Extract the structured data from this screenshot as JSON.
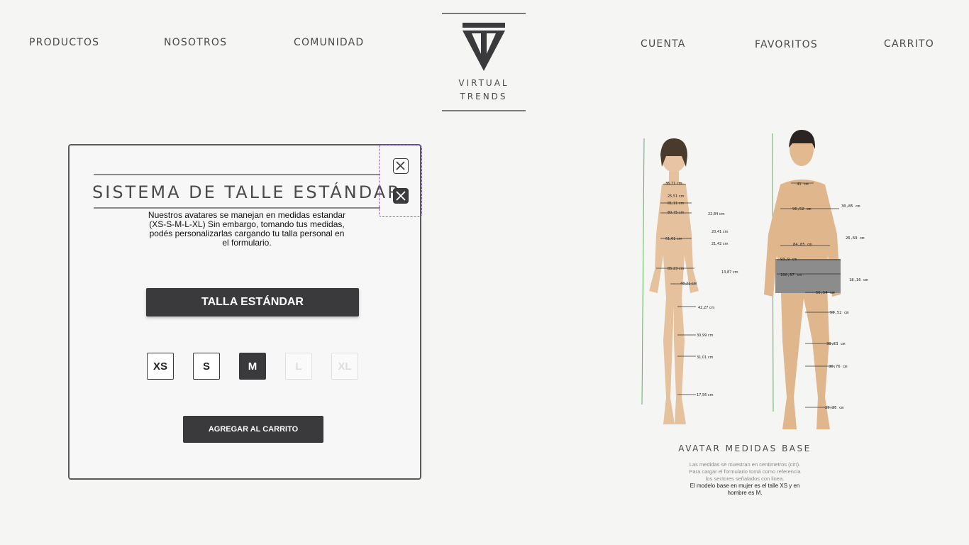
{
  "nav": {
    "productos": "PRODUCTOS",
    "nosotros": "NOSOTROS",
    "comunidad": "COMUNIDAD",
    "cuenta": "CUENTA",
    "favoritos": "FAVORITOS",
    "carrito": "CARRITO"
  },
  "logo": {
    "line1": "VIRTUAL",
    "line2": "TRENDS"
  },
  "modal": {
    "title": "SISTEMA DE TALLE ESTÁNDAR",
    "description": "Nuestros avatares se manejan en medidas estandar (XS-S-M-L-XL) Sin embargo, tomando tus medidas, podés personalizarlas cargando tu talla personal en el formulario.",
    "standard_button": "TALLA ESTÁNDAR",
    "sizes": [
      "XS",
      "S",
      "M",
      "L",
      "XL"
    ],
    "selected_size": "M",
    "add_to_cart": "AGREGAR AL CARRITO"
  },
  "avatar_measurements": {
    "woman": [
      "36,71 cm",
      "25,51 cm",
      "81,11 cm",
      "80,75 cm",
      "61,61 cm",
      "85,23 cm",
      "22,84 cm",
      "20,41 cm",
      "21,42 cm",
      "13,87 cm",
      "48,21 cm",
      "42,27 cm",
      "30,99 cm",
      "31,01 cm",
      "17,56 cm"
    ],
    "man": [
      "41 cm",
      "96,52 cm",
      "84,85 cm",
      "93,9 cm",
      "100,57 cm",
      "30,85 cm",
      "26,69 cm",
      "18,16 cm",
      "56,54 cm",
      "50,52 cm",
      "38,23 cm",
      "36,76 cm",
      "25,25 cm"
    ]
  },
  "caption": {
    "title": "AVATAR MEDIDAS BASE",
    "line1": "Las medidas se muestran en centimetros (cm).",
    "line2": "Para cargar el formulario tomá como referencia",
    "line3": "los sectores señalados con linea.",
    "line4": "El modelo base en mujer es el talle  XS y en",
    "line5": "hombre es M."
  },
  "colors": {
    "background": "#f5f5f3",
    "dark": "#3a3a3d",
    "accent_dashed": "#8a5cd6"
  }
}
